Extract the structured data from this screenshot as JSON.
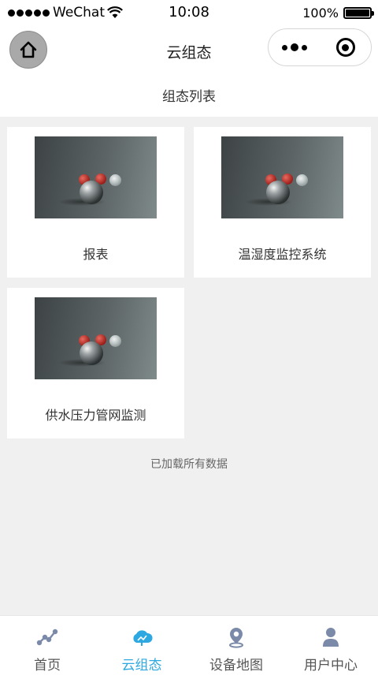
{
  "status_bar": {
    "carrier": "WeChat",
    "time": "10:08",
    "battery": "100%"
  },
  "navbar": {
    "title": "云组态"
  },
  "subheader": {
    "title": "组态列表"
  },
  "cards": [
    {
      "label": "报表"
    },
    {
      "label": "温湿度监控系统"
    },
    {
      "label": "供水压力管网监测"
    }
  ],
  "footer_text": "已加载所有数据",
  "tabbar": {
    "items": [
      {
        "label": "首页",
        "icon": "trend-line-icon",
        "active": false
      },
      {
        "label": "云组态",
        "icon": "cloud-icon",
        "active": true
      },
      {
        "label": "设备地图",
        "icon": "map-pin-icon",
        "active": false
      },
      {
        "label": "用户中心",
        "icon": "user-icon",
        "active": false
      }
    ]
  },
  "colors": {
    "accent": "#2ea8e0",
    "inactive_icon": "#7a8aa8"
  }
}
